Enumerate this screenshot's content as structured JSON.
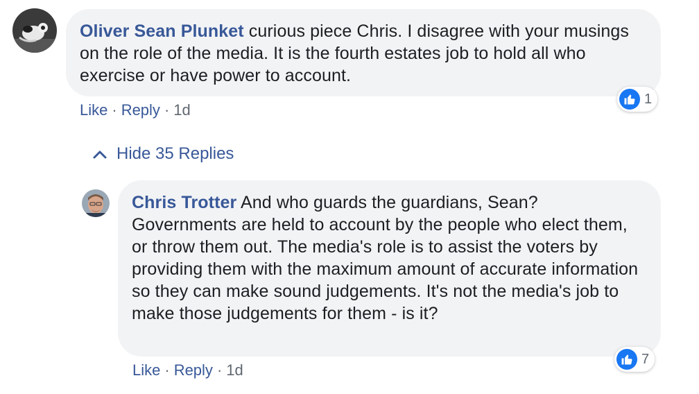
{
  "comment": {
    "author": "Oliver Sean Plunket",
    "text": "curious piece Chris. I disagree with your musings on the role of the media. It is the fourth estates job to hold all who exercise or have power to account.",
    "like_label": "Like",
    "reply_label": "Reply",
    "separator": "·",
    "time": "1d",
    "reaction_count": "1"
  },
  "replies_toggle": {
    "label": "Hide 35 Replies"
  },
  "reply": {
    "author": "Chris Trotter",
    "text": "And who guards the guardians, Sean? Governments are held to account by the people who elect them, or throw them out. The media's role is to assist the voters by providing them with the maximum amount of accurate information so they can make sound judgements. It's not the media's job to make those judgements for them - is it?",
    "like_label": "Like",
    "reply_label": "Reply",
    "separator": "·",
    "time": "1d",
    "reaction_count": "7"
  },
  "icons": {
    "reaction": "thumbs-up-icon",
    "toggle": "chevron-up-icon"
  },
  "colors": {
    "author": "#385898",
    "bubble": "#f2f3f5",
    "like_badge": "#1877f2",
    "meta": "#606770"
  }
}
